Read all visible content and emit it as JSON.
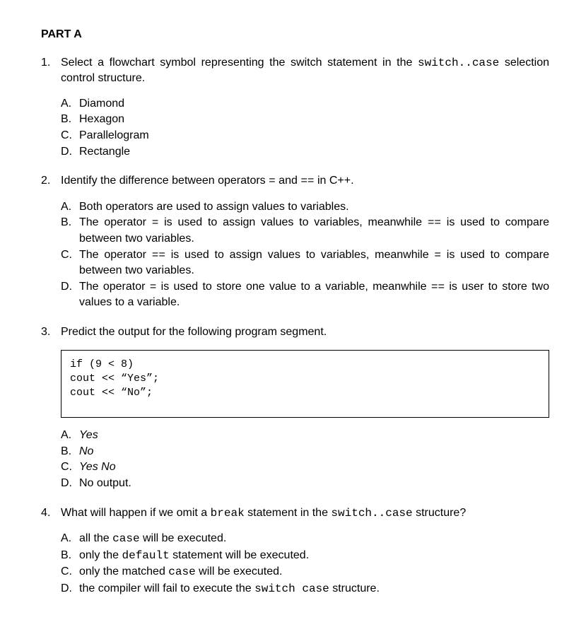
{
  "section_title": "PART A",
  "questions": [
    {
      "num": "1.",
      "text_parts": [
        {
          "t": "Select a flowchart symbol representing the switch statement in the ",
          "c": ""
        },
        {
          "t": "switch..case",
          "c": "mono"
        },
        {
          "t": " selection control structure.",
          "c": ""
        }
      ],
      "options": [
        {
          "letter": "A.",
          "parts": [
            {
              "t": "Diamond",
              "c": ""
            }
          ]
        },
        {
          "letter": "B.",
          "parts": [
            {
              "t": "Hexagon",
              "c": ""
            }
          ]
        },
        {
          "letter": "C.",
          "parts": [
            {
              "t": "Parallelogram",
              "c": ""
            }
          ]
        },
        {
          "letter": "D.",
          "parts": [
            {
              "t": "Rectangle",
              "c": ""
            }
          ]
        }
      ]
    },
    {
      "num": "2.",
      "text_parts": [
        {
          "t": "Identify the difference between operators  ",
          "c": ""
        },
        {
          "t": "=",
          "c": "mono"
        },
        {
          "t": "  and ",
          "c": ""
        },
        {
          "t": "==",
          "c": "mono"
        },
        {
          "t": " in C++.",
          "c": ""
        }
      ],
      "options": [
        {
          "letter": "A.",
          "parts": [
            {
              "t": "Both operators are used to assign values to variables.",
              "c": ""
            }
          ]
        },
        {
          "letter": "B.",
          "parts": [
            {
              "t": "The operator ",
              "c": ""
            },
            {
              "t": "=",
              "c": "mono"
            },
            {
              "t": " is used to assign values to variables, meanwhile ",
              "c": ""
            },
            {
              "t": "==",
              "c": "mono"
            },
            {
              "t": " is used to compare between two variables.",
              "c": ""
            }
          ]
        },
        {
          "letter": "C.",
          "parts": [
            {
              "t": "The operator ",
              "c": ""
            },
            {
              "t": "==",
              "c": "mono"
            },
            {
              "t": " is used to assign values to variables, meanwhile ",
              "c": ""
            },
            {
              "t": "=",
              "c": "mono"
            },
            {
              "t": " is used to compare between two variables.",
              "c": ""
            }
          ]
        },
        {
          "letter": "D.",
          "parts": [
            {
              "t": "The operator ",
              "c": ""
            },
            {
              "t": "=",
              "c": "mono"
            },
            {
              "t": " is used to store one value to a variable, meanwhile ",
              "c": ""
            },
            {
              "t": "==",
              "c": "mono"
            },
            {
              "t": " is user to store two values to a variable.",
              "c": ""
            }
          ]
        }
      ]
    },
    {
      "num": "3.",
      "text_parts": [
        {
          "t": "Predict the output for the following program segment.",
          "c": ""
        }
      ],
      "code": "if (9 < 8)\ncout << “Yes”;\ncout << “No”;",
      "options": [
        {
          "letter": "A.",
          "parts": [
            {
              "t": "Yes",
              "c": "italic"
            }
          ]
        },
        {
          "letter": "B.",
          "parts": [
            {
              "t": "No",
              "c": "italic"
            }
          ]
        },
        {
          "letter": "C.",
          "parts": [
            {
              "t": "Yes No",
              "c": "italic"
            }
          ]
        },
        {
          "letter": "D.",
          "parts": [
            {
              "t": "No output.",
              "c": ""
            }
          ]
        }
      ]
    },
    {
      "num": "4.",
      "text_parts": [
        {
          "t": "What will happen if we omit a ",
          "c": ""
        },
        {
          "t": "break",
          "c": "mono"
        },
        {
          "t": " statement in the ",
          "c": ""
        },
        {
          "t": "switch..case",
          "c": "mono"
        },
        {
          "t": " structure?",
          "c": ""
        }
      ],
      "options": [
        {
          "letter": "A.",
          "parts": [
            {
              "t": "all the ",
              "c": ""
            },
            {
              "t": "case",
              "c": "mono"
            },
            {
              "t": " will be executed.",
              "c": ""
            }
          ]
        },
        {
          "letter": "B.",
          "parts": [
            {
              "t": "only the ",
              "c": ""
            },
            {
              "t": "default",
              "c": "mono"
            },
            {
              "t": " statement will be executed.",
              "c": ""
            }
          ]
        },
        {
          "letter": "C.",
          "parts": [
            {
              "t": "only the matched ",
              "c": ""
            },
            {
              "t": "case",
              "c": "mono"
            },
            {
              "t": " will be executed.",
              "c": ""
            }
          ]
        },
        {
          "letter": "D.",
          "parts": [
            {
              "t": "the compiler will fail to execute the ",
              "c": ""
            },
            {
              "t": "switch case",
              "c": "mono"
            },
            {
              "t": " structure.",
              "c": ""
            }
          ]
        }
      ]
    }
  ]
}
